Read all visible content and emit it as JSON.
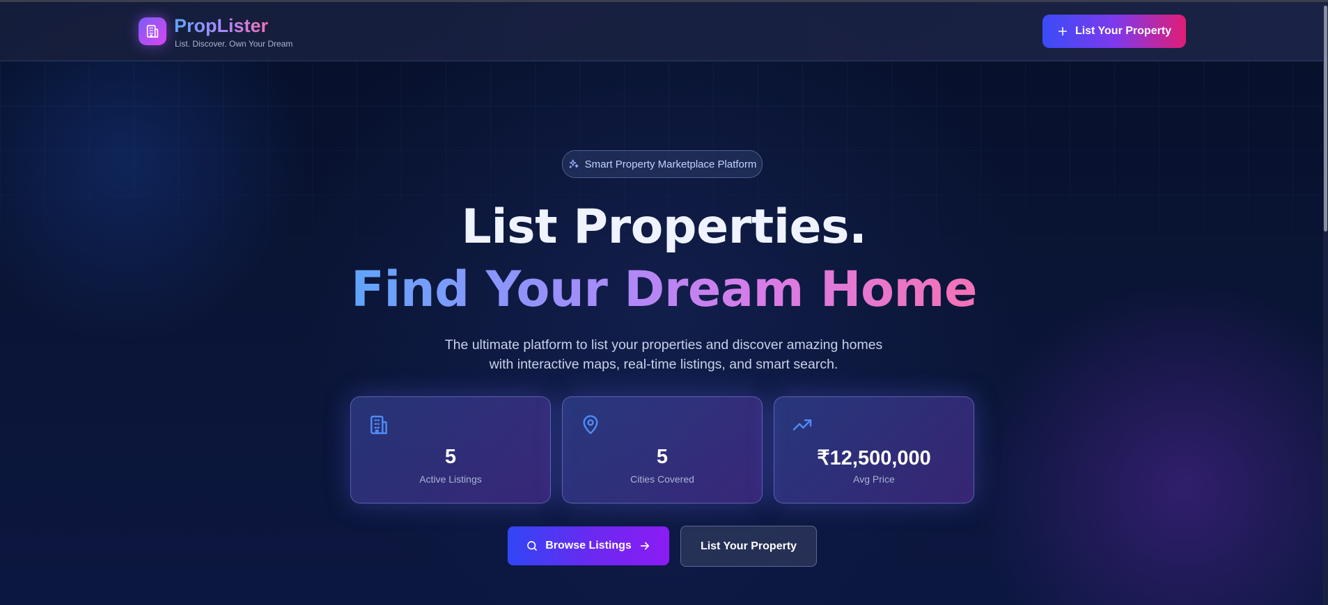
{
  "header": {
    "brand": "PropLister",
    "tagline": "List. Discover. Own Your Dream",
    "cta_label": "List Your Property",
    "logo_icon": "building-icon",
    "cta_icon": "plus-icon"
  },
  "hero": {
    "badge": "Smart Property Marketplace Platform",
    "badge_icon": "sparkles-icon",
    "title_line1": "List Properties.",
    "title_line2": "Find Your Dream Home",
    "subtitle_line1": "The ultimate platform to list your properties and discover amazing homes",
    "subtitle_line2": "with interactive maps, real-time listings, and smart search."
  },
  "stats": [
    {
      "icon": "building-icon",
      "value": "5",
      "label": "Active Listings"
    },
    {
      "icon": "map-pin-icon",
      "value": "5",
      "label": "Cities Covered"
    },
    {
      "icon": "trending-up-icon",
      "value": "₹12,500,000",
      "label": "Avg Price"
    }
  ],
  "actions": {
    "browse_label": "Browse Listings",
    "list_label": "List Your Property"
  },
  "colors": {
    "accent_blue": "#3b82f6",
    "accent_purple": "#7c3aed",
    "accent_pink": "#e11d74",
    "background": "#0a1434"
  }
}
